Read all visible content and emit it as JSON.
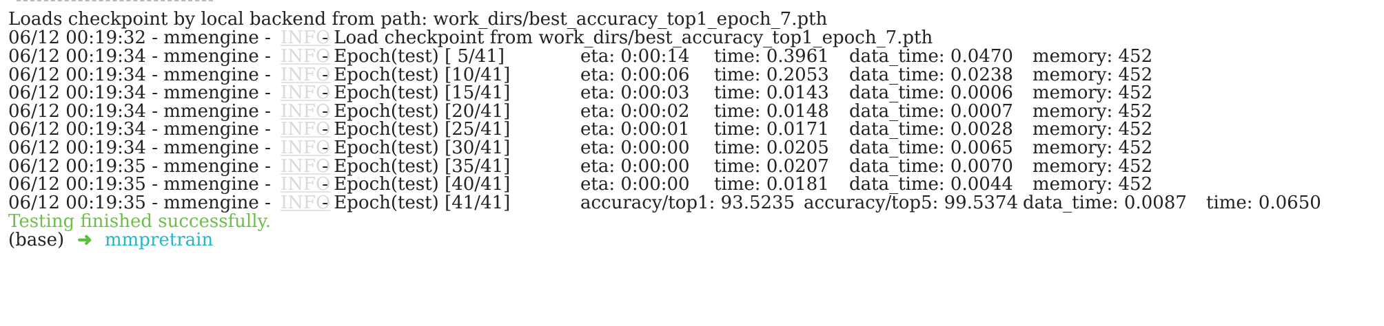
{
  "terminal": {
    "checkpoint_line": "Loads checkpoint by local backend from path: work_dirs/best_accuracy_top1_epoch_7.pth",
    "load_line": {
      "prefix": "06/12 00:19:32 - mmengine - ",
      "level": "INFO",
      "message": " - Load checkpoint from work_dirs/best_accuracy_top1_epoch_7.pth"
    },
    "level_label": "INFO",
    "epoch_rows": [
      {
        "prefix": "06/12 00:19:34 - mmengine - ",
        "stage": " - Epoch(test) [ 5/41]",
        "eta": "eta: 0:00:14",
        "time": "time: 0.3961",
        "data_time": "data_time: 0.0470",
        "memory": "memory: 452"
      },
      {
        "prefix": "06/12 00:19:34 - mmengine - ",
        "stage": " - Epoch(test) [10/41]",
        "eta": "eta: 0:00:06",
        "time": "time: 0.2053",
        "data_time": "data_time: 0.0238",
        "memory": "memory: 452"
      },
      {
        "prefix": "06/12 00:19:34 - mmengine - ",
        "stage": " - Epoch(test) [15/41]",
        "eta": "eta: 0:00:03",
        "time": "time: 0.0143",
        "data_time": "data_time: 0.0006",
        "memory": "memory: 452"
      },
      {
        "prefix": "06/12 00:19:34 - mmengine - ",
        "stage": " - Epoch(test) [20/41]",
        "eta": "eta: 0:00:02",
        "time": "time: 0.0148",
        "data_time": "data_time: 0.0007",
        "memory": "memory: 452"
      },
      {
        "prefix": "06/12 00:19:34 - mmengine - ",
        "stage": " - Epoch(test) [25/41]",
        "eta": "eta: 0:00:01",
        "time": "time: 0.0171",
        "data_time": "data_time: 0.0028",
        "memory": "memory: 452"
      },
      {
        "prefix": "06/12 00:19:34 - mmengine - ",
        "stage": " - Epoch(test) [30/41]",
        "eta": "eta: 0:00:00",
        "time": "time: 0.0205",
        "data_time": "data_time: 0.0065",
        "memory": "memory: 452"
      },
      {
        "prefix": "06/12 00:19:35 - mmengine - ",
        "stage": " - Epoch(test) [35/41]",
        "eta": "eta: 0:00:00",
        "time": "time: 0.0207",
        "data_time": "data_time: 0.0070",
        "memory": "memory: 452"
      },
      {
        "prefix": "06/12 00:19:35 - mmengine - ",
        "stage": " - Epoch(test) [40/41]",
        "eta": "eta: 0:00:00",
        "time": "time: 0.0181",
        "data_time": "data_time: 0.0044",
        "memory": "memory: 452"
      }
    ],
    "final_row": {
      "prefix": "06/12 00:19:35 - mmengine - ",
      "stage": " - Epoch(test) [41/41]",
      "top1": "accuracy/top1: 93.5235",
      "top5": "accuracy/top5: 99.5374",
      "data_time": "data_time: 0.0087",
      "time": "time: 0.0650"
    },
    "success_message": "Testing finished successfully.",
    "prompt": {
      "env": "(base)",
      "arrow_icon": "right-arrow-icon",
      "arrow": "➜",
      "directory": "mmpretrain"
    },
    "colors": {
      "text": "#222222",
      "info": "#d9d9d9",
      "success": "#6cc04a",
      "prompt_dir": "#22b7c9",
      "arrow": "#55c23a"
    }
  }
}
